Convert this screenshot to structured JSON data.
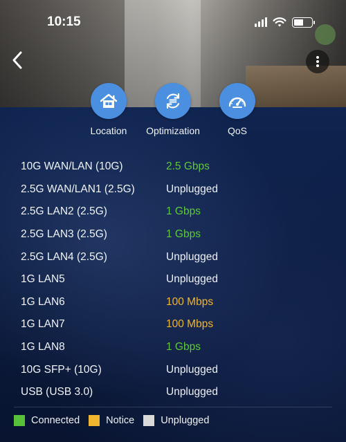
{
  "status_bar": {
    "time": "10:15"
  },
  "header": {
    "back_icon": "chevron-left-icon",
    "more_icon": "vertical-ellipsis-icon"
  },
  "features": [
    {
      "label": "Location",
      "icon": "house-icon"
    },
    {
      "label": "Optimization",
      "icon": "refresh-icon"
    },
    {
      "label": "QoS",
      "icon": "speedometer-icon"
    }
  ],
  "ports": [
    {
      "name": "10G WAN/LAN (10G)",
      "status": "2.5 Gbps",
      "state": "connected"
    },
    {
      "name": "2.5G WAN/LAN1 (2.5G)",
      "status": "Unplugged",
      "state": "unplugged"
    },
    {
      "name": "2.5G LAN2 (2.5G)",
      "status": "1 Gbps",
      "state": "connected"
    },
    {
      "name": "2.5G LAN3 (2.5G)",
      "status": "1 Gbps",
      "state": "connected"
    },
    {
      "name": "2.5G LAN4 (2.5G)",
      "status": "Unplugged",
      "state": "unplugged"
    },
    {
      "name": "1G LAN5",
      "status": "Unplugged",
      "state": "unplugged"
    },
    {
      "name": "1G LAN6",
      "status": "100 Mbps",
      "state": "notice"
    },
    {
      "name": "1G LAN7",
      "status": "100 Mbps",
      "state": "notice"
    },
    {
      "name": "1G LAN8",
      "status": "1 Gbps",
      "state": "connected"
    },
    {
      "name": "10G SFP+ (10G)",
      "status": "Unplugged",
      "state": "unplugged"
    },
    {
      "name": "USB (USB 3.0)",
      "status": "Unplugged",
      "state": "unplugged"
    }
  ],
  "legend": [
    {
      "label": "Connected",
      "color": "#58c13a"
    },
    {
      "label": "Notice",
      "color": "#f1b530"
    },
    {
      "label": "Unplugged",
      "color": "#d9d9d9"
    }
  ],
  "colors": {
    "connected": "#5fc83a",
    "notice": "#f0b62c",
    "unplugged": "#eef0f5",
    "feature_button": "#4a8fe0"
  }
}
